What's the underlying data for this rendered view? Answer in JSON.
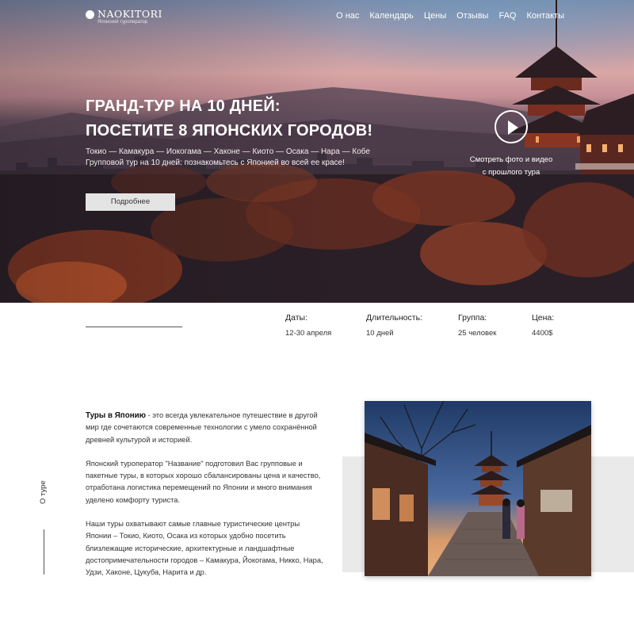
{
  "logo": {
    "name": "NAOKITORI",
    "tagline": "Японский туроператор"
  },
  "nav": {
    "items": [
      {
        "label": "О нас"
      },
      {
        "label": "Календарь"
      },
      {
        "label": "Цены"
      },
      {
        "label": "Отзывы"
      },
      {
        "label": "FAQ"
      },
      {
        "label": "Контакты"
      }
    ]
  },
  "hero": {
    "title_line1": "ГРАНД-ТУР НА 10 ДНЕЙ:",
    "title_line2": "ПОСЕТИТЕ 8 ЯПОНСКИХ ГОРОДОВ!",
    "subtitle_line1": "Токио — Камакура — Иокогама — Хаконе — Киото — Осака — Нара — Кобе",
    "subtitle_line2": "Групповой тур на 10 дней: познакомьтесь с Японией во всей ее красе!",
    "button_label": "Подробнее",
    "video_caption_line1": "Смотреть фото и видео",
    "video_caption_line2": "с прошлого тура"
  },
  "tour_info": {
    "dates": {
      "label": "Даты:",
      "value": "12-30 апреля"
    },
    "duration": {
      "label": "Длительность:",
      "value": "10 дней"
    },
    "group": {
      "label": "Группа:",
      "value": "25 человек"
    },
    "price": {
      "label": "Цена:",
      "value": "4400$"
    }
  },
  "about": {
    "side_label": "О туре",
    "p1_bold": "Туры в Японию",
    "p1_rest": " - это всегда увлекательное путешествие в другой мир где сочетаются современные технологии с умело сохранённой древней культурой и историей.",
    "p2": "Японский туроператор \"Название\" подготовил Вас групповые и пакетные туры, в которых хорошо сбалансированы цена и качество, отработана логистика перемещений по Японии и много внимания уделено комфорту туриста.",
    "p3": "Наши туры охватывают самые главные туристические центры Японии – Токио, Киото, Осака из которых удобно посетить близлежащие исторические, архитектурные и ландшафтные достопримечательности городов – Камакура, Йокогама, Никко, Нара, Удзи, Хаконе, Цукуба, Нарита и др."
  },
  "colors": {
    "accent_button": "#e4e4e4",
    "gray_block": "#eaeaea",
    "text": "#333333"
  }
}
